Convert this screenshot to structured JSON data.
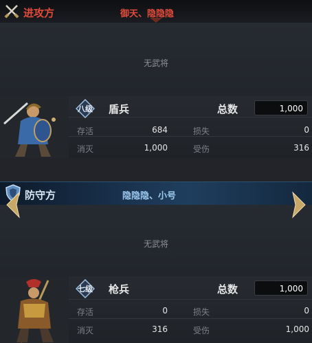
{
  "attacker": {
    "title": "进攻方",
    "players": "御天、隐隐隐",
    "empty_label": "无武将",
    "unit": {
      "rank": "八级",
      "type": "盾兵",
      "total_label": "总数",
      "total": "1,000",
      "stats": [
        {
          "label": "存活",
          "value": "684"
        },
        {
          "label": "损失",
          "value": "0"
        },
        {
          "label": "消灭",
          "value": "1,000"
        },
        {
          "label": "受伤",
          "value": "316"
        }
      ]
    }
  },
  "defender": {
    "title": "防守方",
    "players": "隐隐隐、小号",
    "empty_label": "无武将",
    "unit": {
      "rank": "七级",
      "type": "枪兵",
      "total_label": "总数",
      "total": "1,000",
      "stats": [
        {
          "label": "存活",
          "value": "0"
        },
        {
          "label": "损失",
          "value": "0"
        },
        {
          "label": "消灭",
          "value": "316"
        },
        {
          "label": "受伤",
          "value": "1,000"
        }
      ]
    }
  },
  "colors": {
    "attacker_accent": "#e14b3a",
    "defender_accent": "#7fb8e8",
    "arrow_gold": "#c8a868"
  },
  "icons": {
    "attacker": "crossed-swords-icon",
    "defender": "shield-icon",
    "prev": "chevron-left-icon",
    "next": "chevron-right-icon"
  }
}
